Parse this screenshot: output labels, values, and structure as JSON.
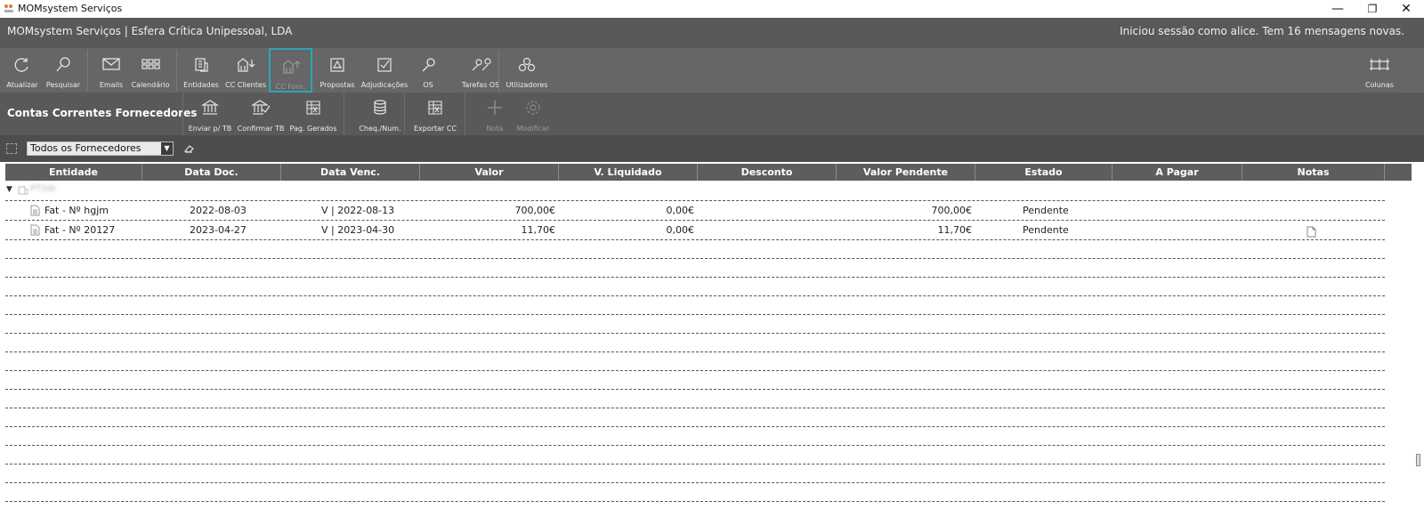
{
  "window": {
    "title": "MOMsystem Serviços",
    "minimize": "—",
    "maximize": "❐",
    "close": "✕"
  },
  "header": {
    "company": "MOMsystem Serviços | Esfera Crítica Unipessoal, LDA",
    "session": "Iniciou sessão como alice.  Tem 16 mensagens novas."
  },
  "toolbar": {
    "buttons": [
      {
        "label": "Atualizar",
        "icon": "refresh-icon"
      },
      {
        "label": "Pesquisar",
        "icon": "search-icon"
      },
      {
        "label": "Emails",
        "icon": "mail-icon"
      },
      {
        "label": "Calendário",
        "icon": "calendar-icon"
      },
      {
        "label": "Entidades",
        "icon": "entities-icon"
      },
      {
        "label": "CC Clientes",
        "icon": "cc-clients-icon"
      },
      {
        "label": "CC Forn.",
        "icon": "cc-suppliers-icon"
      },
      {
        "label": "Propostas",
        "icon": "proposals-icon"
      },
      {
        "label": "Adjudicações",
        "icon": "awards-icon"
      },
      {
        "label": "OS",
        "icon": "wrench-icon"
      },
      {
        "label": "Tarefas OS",
        "icon": "tasks-icon"
      },
      {
        "label": "Utilizadores",
        "icon": "users-icon"
      },
      {
        "label": "Colunas",
        "icon": "columns-icon"
      }
    ],
    "active": "CC Forn."
  },
  "subbar": {
    "title": "Contas Correntes Fornecedores",
    "buttons": [
      {
        "label": "Enviar p/ TB",
        "icon": "bank-icon"
      },
      {
        "label": "Confirmar TB",
        "icon": "bank-check-icon"
      },
      {
        "label": "Pag. Gerados",
        "icon": "excel-icon"
      },
      {
        "label": "Cheq./Num.",
        "icon": "database-icon"
      },
      {
        "label": "Exportar CC",
        "icon": "export-excel-icon"
      },
      {
        "label": "Nota",
        "icon": "plus-icon",
        "disabled": true
      },
      {
        "label": "Modificar",
        "icon": "gear-icon",
        "disabled": true
      }
    ]
  },
  "filter": {
    "selected": "Todos os Fornecedores"
  },
  "table": {
    "columns": [
      "Entidade",
      "Data Doc.",
      "Data Venc.",
      "Valor",
      "V. Liquidado",
      "Desconto",
      "Valor Pendente",
      "Estado",
      "A Pagar",
      "Notas"
    ],
    "group": {
      "name": "PTSW"
    },
    "rows": [
      {
        "entidade": "Fat - Nº hgjm",
        "data_doc": "2022-08-03",
        "data_venc": "V | 2022-08-13",
        "valor": "700,00€",
        "v_liquidado": "0,00€",
        "desconto": "",
        "valor_pendente": "700,00€",
        "estado": "Pendente",
        "a_pagar": "",
        "has_note": false
      },
      {
        "entidade": "Fat - Nº 20127",
        "data_doc": "2023-04-27",
        "data_venc": "V | 2023-04-30",
        "valor": "11,70€",
        "v_liquidado": "0,00€",
        "desconto": "",
        "valor_pendente": "11,70€",
        "estado": "Pendente",
        "a_pagar": "",
        "has_note": true
      }
    ]
  },
  "colors": {
    "header_bg": "#595959",
    "toolbar_bg": "#666666",
    "active_border": "#2aa6b8",
    "table_header_bg": "#5d5d5d"
  }
}
